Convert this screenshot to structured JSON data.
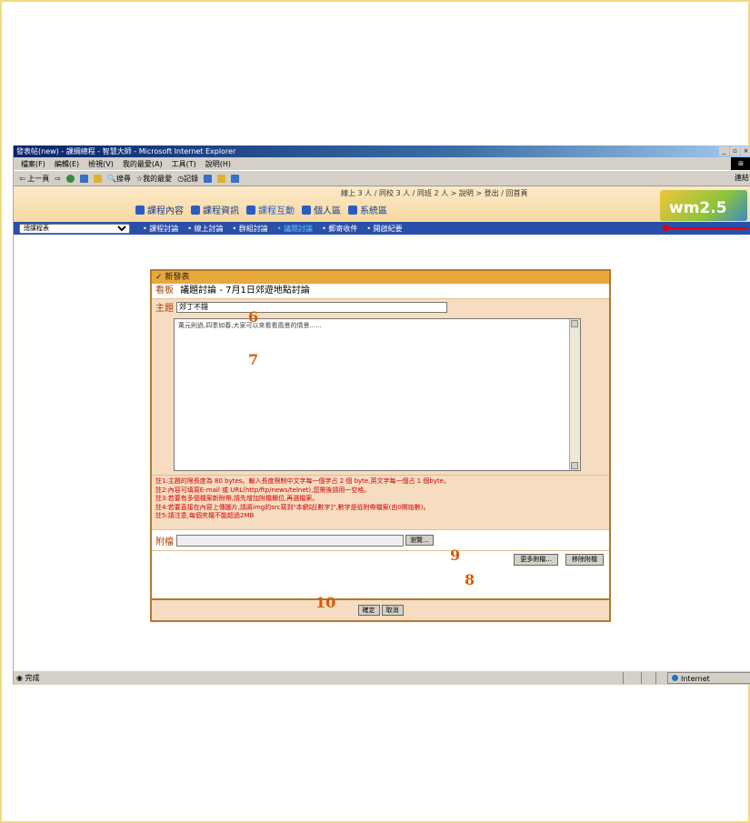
{
  "window": {
    "title": "發表帖(new) - 課綱總程 - 智慧大師 - Microsoft Internet Explorer",
    "controls": [
      "_",
      "▫",
      "×"
    ]
  },
  "menu": {
    "items": [
      "檔案(F)",
      "編輯(E)",
      "檢視(V)",
      "我的最愛(A)",
      "工具(T)",
      "說明(H)"
    ]
  },
  "toolbar": {
    "back": "上一頁",
    "search": "搜尋",
    "favorites": "我的最愛",
    "history": "記錄",
    "links": "連結"
  },
  "banner": {
    "online_status": "線上 3 人 / 同校 3 人 / 同班 2 人 > 說明 > 登出 / 回首頁",
    "tabs": [
      {
        "label": "課程內容"
      },
      {
        "label": "課程資訊"
      },
      {
        "label": "課程互動"
      },
      {
        "label": "個人區"
      },
      {
        "label": "系統區"
      }
    ],
    "logo_text": "wm2.5"
  },
  "nav": {
    "course_select": "總課程表",
    "items": [
      "課程討論",
      "線上討論",
      "群組討論",
      "議題討論",
      "郵寄收件",
      "開啟紀要"
    ],
    "current_index": 3
  },
  "form": {
    "header": "新發表",
    "board_label": "看板",
    "board_value": "議題討論 - 7月1日郊遊地點討論",
    "subject_label": "主題",
    "subject_value": "郊丁不錯",
    "body_text": "萬元則過,四季如春,大家可以來看看風景的情景......",
    "notes": [
      "註1:主題的限長度為 80 bytes。輸入長度限制中文字每一個字占 2 個 byte,英文字每一個占 1 個byte。",
      "註2:內容可填寫E-mail 或 URL(http/ftp/news/telnet),您需後請用一空格。",
      "註3:若要有多個檔案新附帶,請先增加附檔欄位,再選檔案。",
      "註4:若要直接在內容上傳圖片,請將img的src寫到\"本網站[數字]\",數字是從附帶檔案(由0開始數)。",
      "註5:請注意,每個夾檔不能超過2MB"
    ],
    "attach_label": "附檔",
    "browse_button": "瀏覽...",
    "more_attach_button": "更多附檔...",
    "remove_attach_button": "移除附檔",
    "ok_button": "確定",
    "cancel_button": "取消"
  },
  "markers": {
    "m6": "6",
    "m7": "7",
    "m8": "8",
    "m9": "9",
    "m10": "10"
  },
  "statusbar": {
    "left": "完成",
    "zone": "Internet"
  }
}
